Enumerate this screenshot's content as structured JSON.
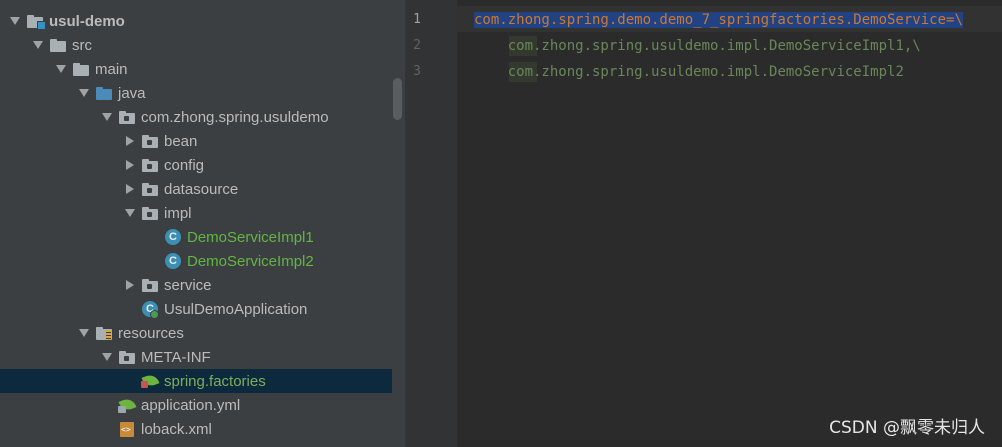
{
  "project_tree": {
    "items": [
      {
        "label": "usul-demo",
        "depth": 0,
        "arrow": "down",
        "icon": "module-folder-icon",
        "style": "bold"
      },
      {
        "label": "src",
        "depth": 1,
        "arrow": "down",
        "icon": "folder-icon",
        "style": "normal"
      },
      {
        "label": "main",
        "depth": 2,
        "arrow": "down",
        "icon": "folder-icon",
        "style": "normal"
      },
      {
        "label": "java",
        "depth": 3,
        "arrow": "down",
        "icon": "source-folder-icon",
        "style": "normal"
      },
      {
        "label": "com.zhong.spring.usuldemo",
        "depth": 4,
        "arrow": "down",
        "icon": "package-icon",
        "style": "normal"
      },
      {
        "label": "bean",
        "depth": 5,
        "arrow": "right",
        "icon": "package-icon",
        "style": "normal"
      },
      {
        "label": "config",
        "depth": 5,
        "arrow": "right",
        "icon": "package-icon",
        "style": "normal"
      },
      {
        "label": "datasource",
        "depth": 5,
        "arrow": "right",
        "icon": "package-icon",
        "style": "normal"
      },
      {
        "label": "impl",
        "depth": 5,
        "arrow": "down",
        "icon": "package-icon",
        "style": "normal"
      },
      {
        "label": "DemoServiceImpl1",
        "depth": 6,
        "arrow": "none",
        "icon": "class-icon",
        "style": "green"
      },
      {
        "label": "DemoServiceImpl2",
        "depth": 6,
        "arrow": "none",
        "icon": "class-icon",
        "style": "green"
      },
      {
        "label": "service",
        "depth": 5,
        "arrow": "right",
        "icon": "package-icon",
        "style": "normal"
      },
      {
        "label": "UsulDemoApplication",
        "depth": 5,
        "arrow": "none",
        "icon": "spring-boot-class-icon",
        "style": "normal"
      },
      {
        "label": "resources",
        "depth": 3,
        "arrow": "down",
        "icon": "resources-folder-icon",
        "style": "normal"
      },
      {
        "label": "META-INF",
        "depth": 4,
        "arrow": "down",
        "icon": "package-icon",
        "style": "normal"
      },
      {
        "label": "spring.factories",
        "depth": 5,
        "arrow": "none",
        "icon": "spring-factories-icon",
        "style": "green2",
        "selected": true
      },
      {
        "label": "application.yml",
        "depth": 4,
        "arrow": "none",
        "icon": "spring-config-icon",
        "style": "normal"
      },
      {
        "label": "loback.xml",
        "depth": 4,
        "arrow": "none",
        "icon": "xml-file-icon",
        "style": "normal"
      }
    ]
  },
  "editor": {
    "line_numbers": [
      "1",
      "2",
      "3"
    ],
    "lines": [
      {
        "parts": [
          {
            "text": "com.zhong.spring.demo.demo_7_springfactories.DemoService",
            "cls": "key sel"
          },
          {
            "text": "=\\",
            "cls": "sep sel"
          }
        ]
      },
      {
        "parts": [
          {
            "text": "    ",
            "cls": ""
          },
          {
            "text": "com.zhong.spring.usuldemo.impl.DemoServiceImpl1,\\",
            "cls": "val"
          }
        ]
      },
      {
        "parts": [
          {
            "text": "    ",
            "cls": ""
          },
          {
            "text": "com.zhong.spring.usuldemo.impl.DemoServiceImpl2",
            "cls": "val"
          }
        ]
      }
    ]
  },
  "watermark": "CSDN @飘零未归人",
  "colors": {
    "background": "#2b2b2b",
    "tree": "#3c3f41",
    "selection": "#0d293e",
    "accent_green": "#62b543"
  }
}
